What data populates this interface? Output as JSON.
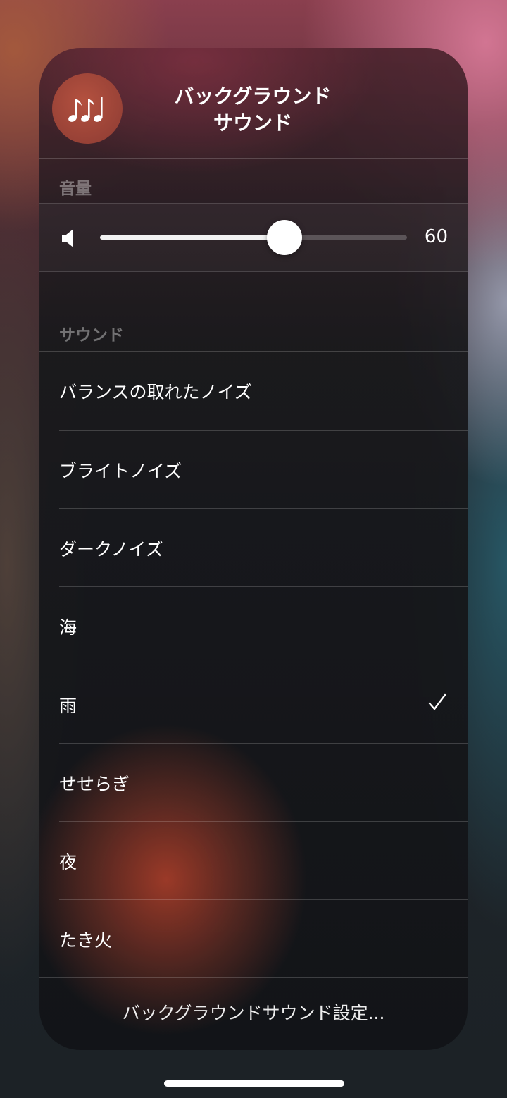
{
  "header": {
    "icon": "music-notes-icon",
    "title_line1": "バックグラウンド",
    "title_line2": "サウンド"
  },
  "volume": {
    "section_label": "音量",
    "icon": "speaker-icon",
    "value": 60,
    "value_label": "60"
  },
  "sounds": {
    "section_label": "サウンド",
    "items": [
      {
        "label": "バランスの取れたノイズ",
        "selected": false
      },
      {
        "label": "ブライトノイズ",
        "selected": false
      },
      {
        "label": "ダークノイズ",
        "selected": false
      },
      {
        "label": "海",
        "selected": false
      },
      {
        "label": "雨",
        "selected": true
      },
      {
        "label": "せせらぎ",
        "selected": false
      },
      {
        "label": "夜",
        "selected": false
      },
      {
        "label": "たき火",
        "selected": false
      }
    ]
  },
  "footer": {
    "settings_label": "バックグラウンドサウンド設定..."
  }
}
